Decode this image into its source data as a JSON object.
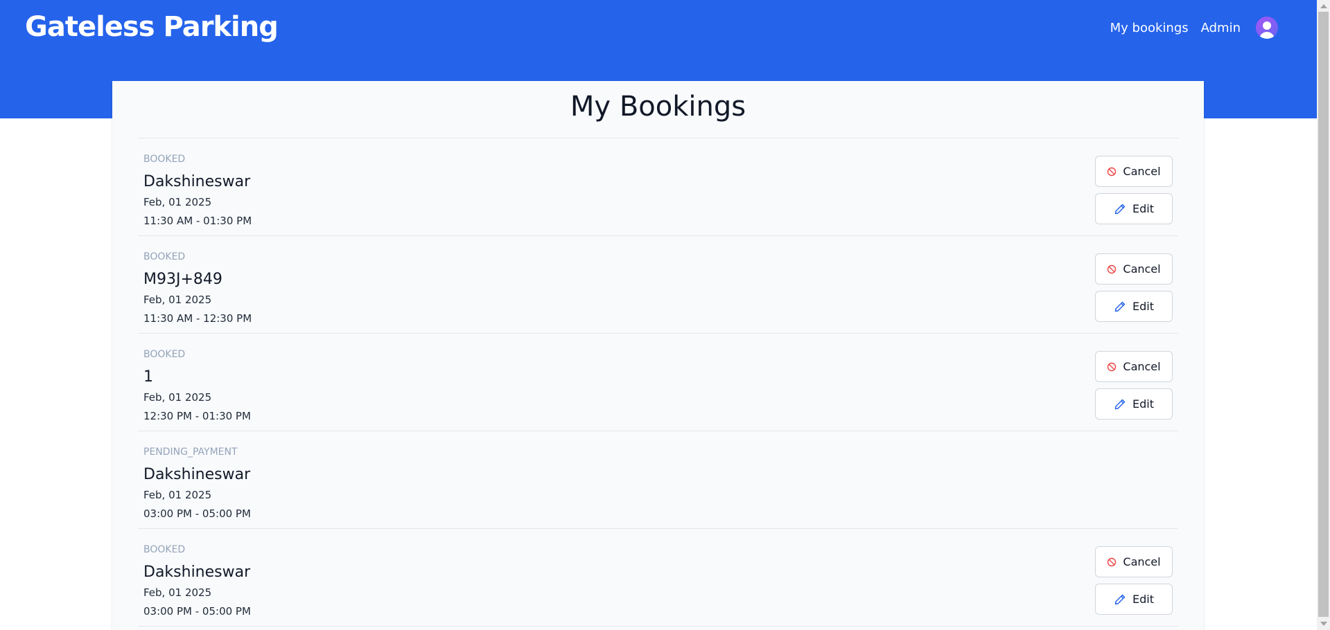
{
  "app": {
    "brand": "Gateless Parking"
  },
  "nav": {
    "my_bookings": "My bookings",
    "admin": "Admin"
  },
  "page": {
    "title": "My Bookings"
  },
  "colors": {
    "header": "#2563eb",
    "cancel_icon": "#ef4444",
    "edit_icon": "#2563eb"
  },
  "icons": {
    "cancel": "ban-icon",
    "edit": "pencil-icon",
    "avatar": "user-avatar-icon"
  },
  "actions": {
    "cancel_label": "Cancel",
    "edit_label": "Edit"
  },
  "bookings": [
    {
      "status": "BOOKED",
      "location": "Dakshineswar",
      "date": "Feb, 01 2025",
      "time": "11:30 AM - 01:30 PM",
      "actions": true
    },
    {
      "status": "BOOKED",
      "location": "M93J+849",
      "date": "Feb, 01 2025",
      "time": "11:30 AM - 12:30 PM",
      "actions": true
    },
    {
      "status": "BOOKED",
      "location": "1",
      "date": "Feb, 01 2025",
      "time": "12:30 PM - 01:30 PM",
      "actions": true
    },
    {
      "status": "PENDING_PAYMENT",
      "location": "Dakshineswar",
      "date": "Feb, 01 2025",
      "time": "03:00 PM - 05:00 PM",
      "actions": false
    },
    {
      "status": "BOOKED",
      "location": "Dakshineswar",
      "date": "Feb, 01 2025",
      "time": "03:00 PM - 05:00 PM",
      "actions": true
    }
  ]
}
